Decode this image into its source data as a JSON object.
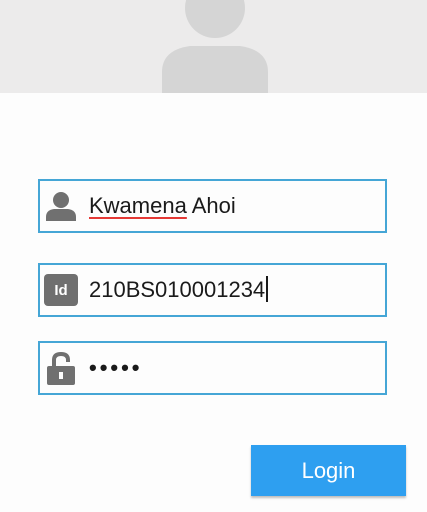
{
  "header": {
    "avatar_icon": "user-silhouette-icon",
    "background_color": "#ecebeb"
  },
  "form": {
    "name_field": {
      "icon": "person-icon",
      "value_first": "Kwamena",
      "value_rest": " Ahoi"
    },
    "id_field": {
      "icon": "id-card-icon",
      "icon_text": "Id",
      "value": "210BS010001234"
    },
    "password_field": {
      "icon": "lock-icon",
      "masked_value": "•••••"
    },
    "border_color": "#45a6d6"
  },
  "login_button": {
    "label": "Login",
    "color": "#2e9ff0"
  }
}
